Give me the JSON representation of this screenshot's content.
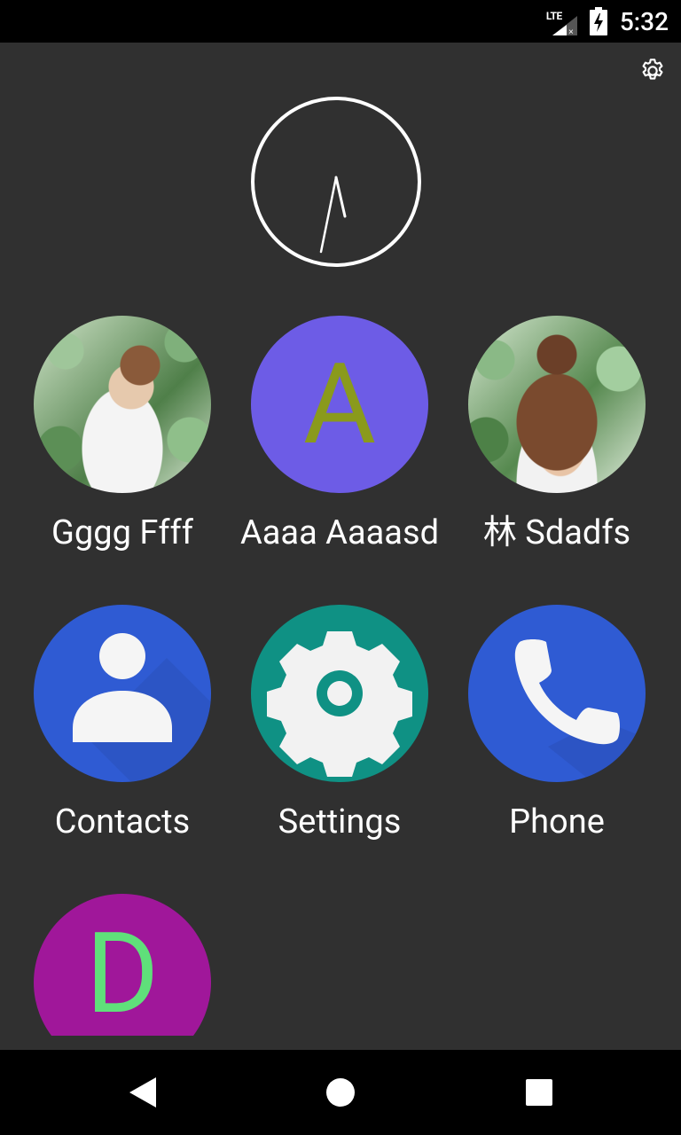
{
  "status_bar": {
    "network": "LTE",
    "time": "5:32",
    "icons": [
      "lte-signal-icon",
      "battery-charging-icon"
    ]
  },
  "top": {
    "settings_icon": "gear-icon"
  },
  "favorites": [
    {
      "label": "Gggg Ffff",
      "type": "photo"
    },
    {
      "label": "Aaaa Aaaasd",
      "type": "letter",
      "letter": "A",
      "bg": "#6d5ce6",
      "fg": "#8a9a1c"
    },
    {
      "label": "林 Sdadfs",
      "type": "photo"
    }
  ],
  "apps": [
    {
      "label": "Contacts",
      "icon": "contacts-icon",
      "bg": "#2f5bd3"
    },
    {
      "label": "Settings",
      "icon": "settings-app-icon",
      "bg": "#0f9184"
    },
    {
      "label": "Phone",
      "icon": "phone-icon",
      "bg": "#2f5bd3"
    }
  ],
  "partial": {
    "letter": "D",
    "bg": "#a0179a",
    "fg": "#5fe07a"
  },
  "nav_bar": {
    "icons": [
      "back-icon",
      "home-icon",
      "recents-icon"
    ]
  }
}
